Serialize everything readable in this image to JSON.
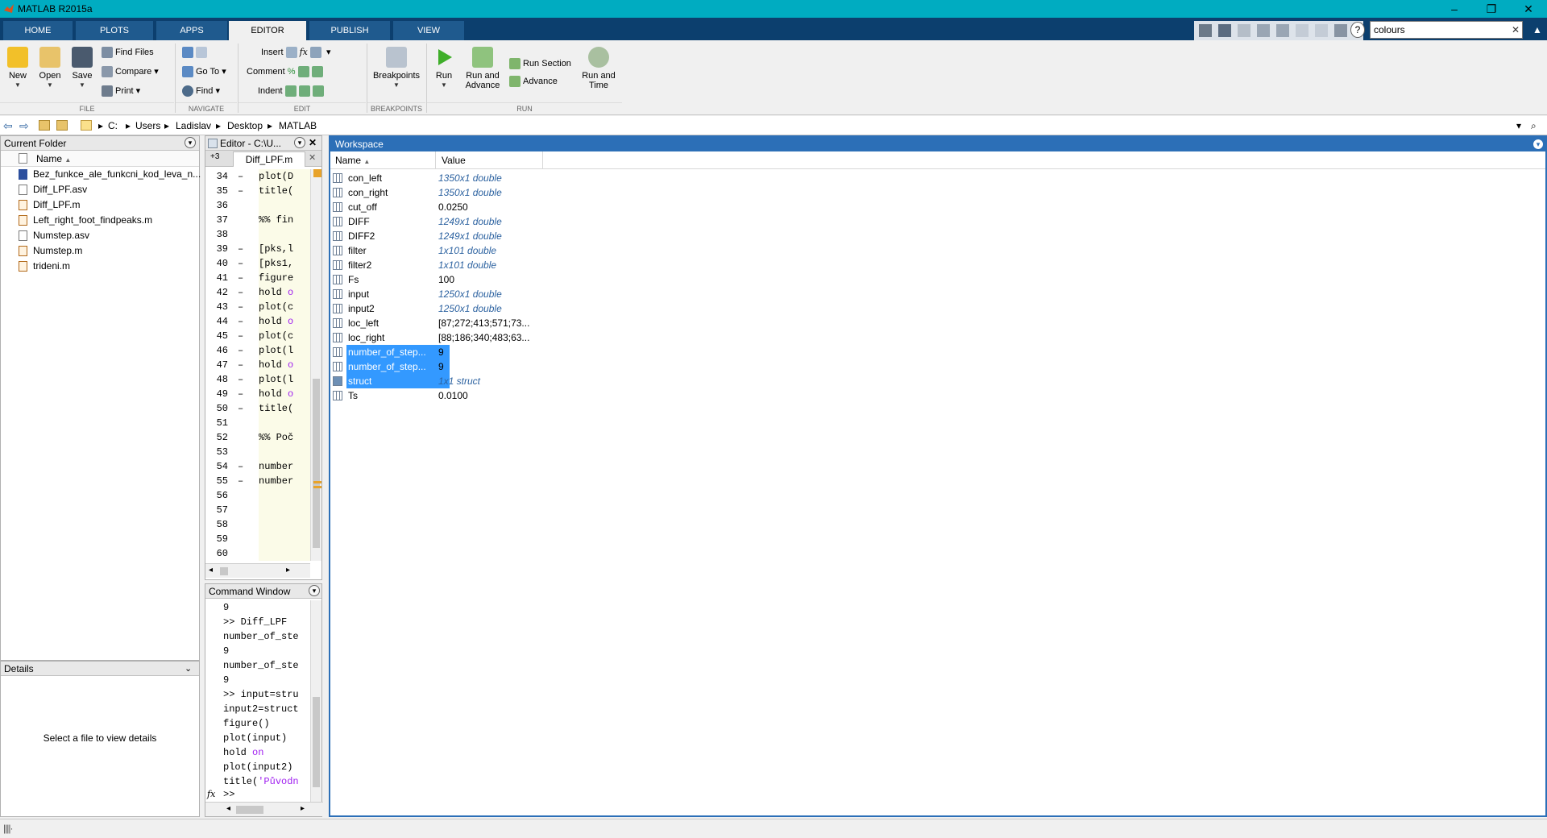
{
  "app": {
    "title": "MATLAB R2015a"
  },
  "tabs": [
    "HOME",
    "PLOTS",
    "APPS",
    "EDITOR",
    "PUBLISH",
    "VIEW"
  ],
  "search": {
    "value": "colours"
  },
  "ribbon": {
    "file": {
      "group": "FILE",
      "new": "New",
      "open": "Open",
      "save": "Save",
      "find_files": "Find Files",
      "compare": "Compare",
      "print": "Print"
    },
    "navigate": {
      "group": "NAVIGATE",
      "go_to": "Go To",
      "find": "Find"
    },
    "edit": {
      "group": "EDIT",
      "insert": "Insert",
      "comment": "Comment",
      "indent": "Indent"
    },
    "breakpoints": {
      "group": "BREAKPOINTS",
      "label": "Breakpoints"
    },
    "run": {
      "group": "RUN",
      "run": "Run",
      "run_advance_1": "Run and",
      "run_advance_2": "Advance",
      "run_section": "Run Section",
      "advance": "Advance",
      "run_time_1": "Run and",
      "run_time_2": "Time"
    }
  },
  "path": [
    "C:",
    "Users",
    "Ladislav",
    "Desktop",
    "MATLAB"
  ],
  "current_folder": {
    "title": "Current Folder",
    "column": "Name",
    "files": [
      {
        "name": "Bez_funkce_ale_funkcni_kod_leva_n...",
        "kind": "w"
      },
      {
        "name": "Diff_LPF.asv",
        "kind": "a"
      },
      {
        "name": "Diff_LPF.m",
        "kind": "m"
      },
      {
        "name": "Left_right_foot_findpeaks.m",
        "kind": "m"
      },
      {
        "name": "Numstep.asv",
        "kind": "a"
      },
      {
        "name": "Numstep.m",
        "kind": "m"
      },
      {
        "name": "trideni.m",
        "kind": "m"
      }
    ]
  },
  "details": {
    "title": "Details",
    "empty": "Select a file to view details"
  },
  "editor": {
    "title": "Editor - C:\\U...",
    "tab_count": "+3",
    "tab": "Diff_LPF.m",
    "lines": [
      {
        "no": "34",
        "dash": "–",
        "code": "plot(D"
      },
      {
        "no": "35",
        "dash": "–",
        "code": "title("
      },
      {
        "no": "36",
        "dash": "",
        "code": ""
      },
      {
        "no": "37",
        "dash": "",
        "code": "%% fin",
        "type": "cmt"
      },
      {
        "no": "38",
        "dash": "",
        "code": ""
      },
      {
        "no": "39",
        "dash": "–",
        "code": "[pks,l"
      },
      {
        "no": "40",
        "dash": "–",
        "code": "[pks1,"
      },
      {
        "no": "41",
        "dash": "–",
        "code": "figure"
      },
      {
        "no": "42",
        "dash": "–",
        "code": "hold o",
        "type": "str"
      },
      {
        "no": "43",
        "dash": "–",
        "code": "plot(c"
      },
      {
        "no": "44",
        "dash": "–",
        "code": "hold o",
        "type": "str"
      },
      {
        "no": "45",
        "dash": "–",
        "code": "plot(c"
      },
      {
        "no": "46",
        "dash": "–",
        "code": "plot(l"
      },
      {
        "no": "47",
        "dash": "–",
        "code": "hold o",
        "type": "str"
      },
      {
        "no": "48",
        "dash": "–",
        "code": "plot(l"
      },
      {
        "no": "49",
        "dash": "–",
        "code": "hold o",
        "type": "str"
      },
      {
        "no": "50",
        "dash": "–",
        "code": "title("
      },
      {
        "no": "51",
        "dash": "",
        "code": ""
      },
      {
        "no": "52",
        "dash": "",
        "code": "%% Poč",
        "type": "cmt"
      },
      {
        "no": "53",
        "dash": "",
        "code": ""
      },
      {
        "no": "54",
        "dash": "–",
        "code": "number"
      },
      {
        "no": "55",
        "dash": "–",
        "code": "number"
      },
      {
        "no": "56",
        "dash": "",
        "code": ""
      },
      {
        "no": "57",
        "dash": "",
        "code": ""
      },
      {
        "no": "58",
        "dash": "",
        "code": ""
      },
      {
        "no": "59",
        "dash": "",
        "code": ""
      },
      {
        "no": "60",
        "dash": "",
        "code": ""
      }
    ]
  },
  "command_window": {
    "title": "Command Window",
    "lines": [
      {
        "text": "    9"
      },
      {
        "text": ">> Diff_LPF"
      },
      {
        "text": "number_of_ste"
      },
      {
        "text": "    9"
      },
      {
        "text": "number_of_ste"
      },
      {
        "text": "    9"
      },
      {
        "text": ">> input=stru"
      },
      {
        "text": "input2=struct"
      },
      {
        "text": "figure()"
      },
      {
        "text": "plot(input)"
      },
      {
        "text": "hold on",
        "type": "kwtail"
      },
      {
        "text": "plot(input2)"
      },
      {
        "text": "title('Původn",
        "type": "strtail"
      }
    ],
    "prompt": ">>",
    "fx": "fx"
  },
  "workspace": {
    "title": "Workspace",
    "col_name": "Name",
    "col_value": "Value",
    "rows": [
      {
        "name": "con_left",
        "value": "1350x1 double",
        "italic": true
      },
      {
        "name": "con_right",
        "value": "1350x1 double",
        "italic": true
      },
      {
        "name": "cut_off",
        "value": "0.0250"
      },
      {
        "name": "DIFF",
        "value": "1249x1 double",
        "italic": true
      },
      {
        "name": "DIFF2",
        "value": "1249x1 double",
        "italic": true
      },
      {
        "name": "filter",
        "value": "1x101 double",
        "italic": true
      },
      {
        "name": "filter2",
        "value": "1x101 double",
        "italic": true
      },
      {
        "name": "Fs",
        "value": "100"
      },
      {
        "name": "input",
        "value": "1250x1 double",
        "italic": true
      },
      {
        "name": "input2",
        "value": "1250x1 double",
        "italic": true
      },
      {
        "name": "loc_left",
        "value": "[87;272;413;571;73..."
      },
      {
        "name": "loc_right",
        "value": "[88;186;340;483;63..."
      },
      {
        "name": "number_of_step...",
        "value": "9",
        "selected": true
      },
      {
        "name": "number_of_step...",
        "value": "9",
        "selected": true
      },
      {
        "name": "struct",
        "value": "1x1 struct",
        "italic": true,
        "selected": true
      },
      {
        "name": "Ts",
        "value": "0.0100"
      }
    ]
  }
}
